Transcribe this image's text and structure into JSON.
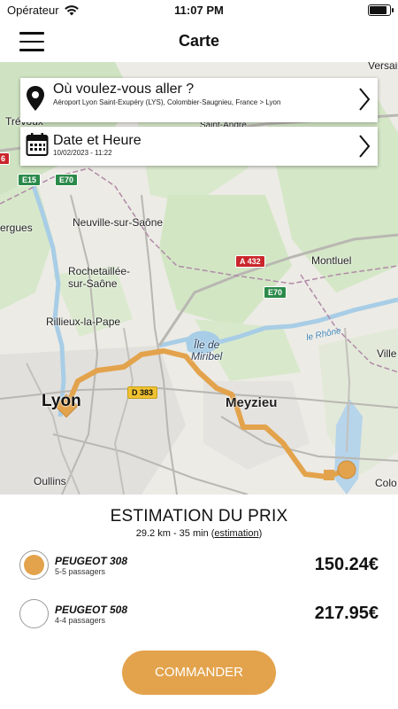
{
  "status_bar": {
    "carrier": "Opérateur",
    "time": "11:07 PM"
  },
  "nav": {
    "title": "Carte"
  },
  "destination_card": {
    "title": "Où voulez-vous aller ?",
    "address": "Aéroport Lyon Saint-Exupéry (LYS), Colombier-Saugnieu, France > Lyon"
  },
  "date_card": {
    "title": "Date et Heure",
    "value": "10/02/2023 - 11:22"
  },
  "map": {
    "places": {
      "versailles": "Versai",
      "trevoux": "Trévoux",
      "neuville": "Neuville-sur-Saône",
      "ergues": "ergues",
      "rochetaillee": "Rochetaillée-\nsur-Saône",
      "rillieux": "Rillieux-la-Pape",
      "montluel": "Montluel",
      "ile_miribel": "Île de\nMiribel",
      "le_rhone": "le Rhône",
      "ville": "Ville",
      "lyon": "Lyon",
      "meyzieu": "Meyzieu",
      "oullins": "Oullins",
      "colo": "Colo",
      "saint_andre": "Saint-André"
    },
    "roads": {
      "e15": "E15",
      "e70_top": "E70",
      "a432": "A 432",
      "e70_right": "E70",
      "d383": "D 383",
      "red_left": "6"
    },
    "route_color": "#e3a34c"
  },
  "estimate": {
    "title": "ESTIMATION DU PRIX",
    "summary": "29.2 km - 35 min",
    "link": "estimation"
  },
  "vehicles": [
    {
      "name": "PEUGEOT 308",
      "passengers": "5-5 passagers",
      "price": "150.24€",
      "selected": true
    },
    {
      "name": "PEUGEOT 508",
      "passengers": "4-4 passagers",
      "price": "217.95€",
      "selected": false
    }
  ],
  "order_button": {
    "label": "COMMANDER"
  },
  "colors": {
    "accent": "#e3a34c"
  }
}
